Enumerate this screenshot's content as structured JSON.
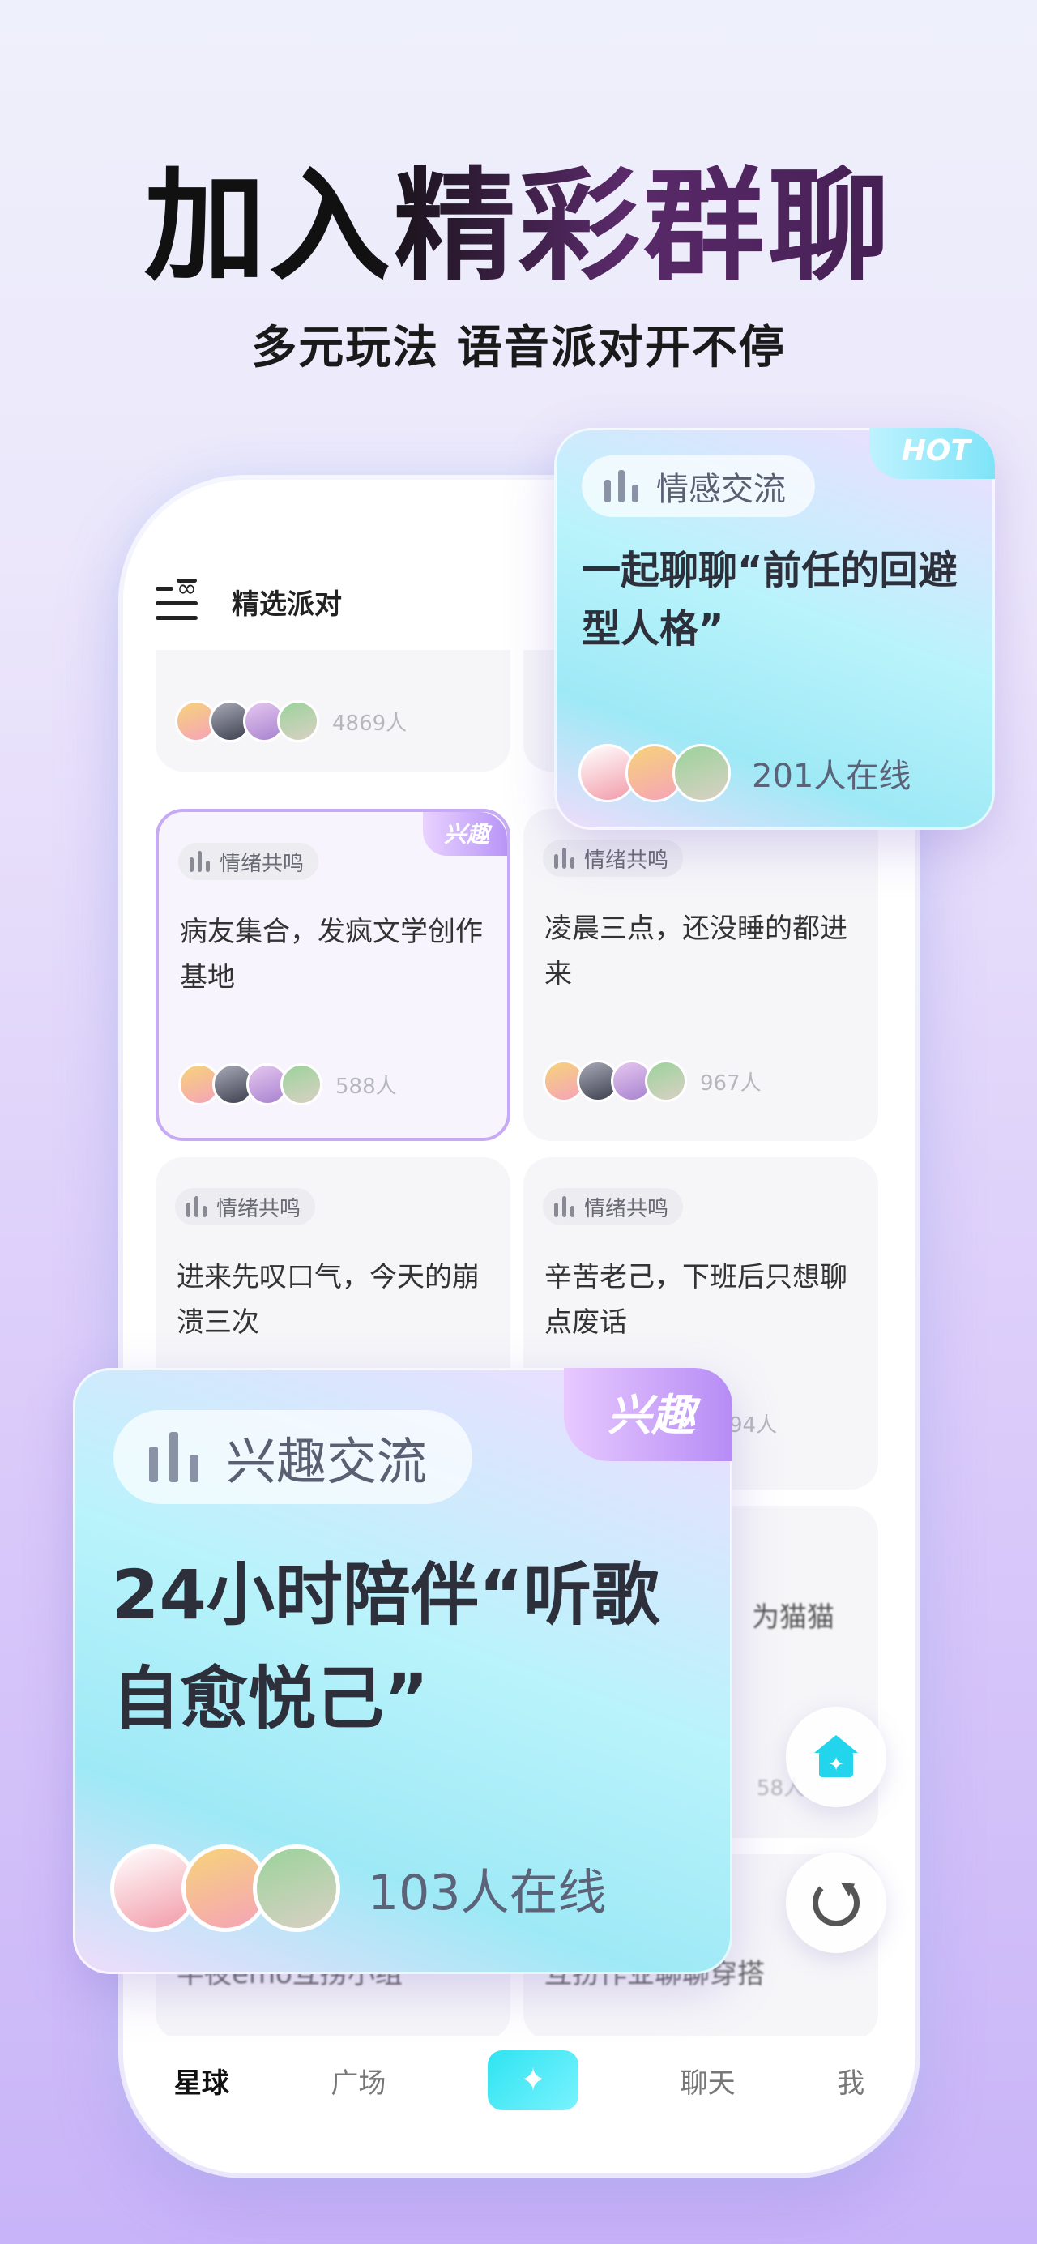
{
  "hero": {
    "title": "加入精彩群聊",
    "subtitle": "多元玩法 语音派对开不停"
  },
  "header": {
    "title": "精选派对"
  },
  "cards": [
    {
      "tag": "",
      "title": "",
      "count": "4869人",
      "badge": ""
    },
    {
      "tag": "情绪共鸣",
      "title": "病友集合，发疯文学创作基地",
      "count": "588人",
      "badge": "兴趣"
    },
    {
      "tag": "情绪共鸣",
      "title": "凌晨三点，还没睡的都进来",
      "count": "967人",
      "badge": ""
    },
    {
      "tag": "情绪共鸣",
      "title": "进来先叹口气，今天的崩溃三次",
      "count": "",
      "badge": ""
    },
    {
      "tag": "情绪共鸣",
      "title": "辛苦老己，下班后只想聊点废话",
      "count": "94人",
      "badge": ""
    }
  ],
  "partial": {
    "right_title": "为猫猫",
    "right_count": "58人",
    "left_bottom": "半夜emo互捞小组",
    "right_bottom": "互扮作业聊聊穿搭"
  },
  "hot_card": {
    "tag": "情感交流",
    "title": "一起聊聊“前任的回避型人格”",
    "badge": "HOT",
    "online": "201人在线"
  },
  "interest_card": {
    "tag": "兴趣交流",
    "title": "24小时陪伴“听歌自愈悦己”",
    "badge": "兴趣",
    "online": "103人在线"
  },
  "nav": {
    "items": [
      "星球",
      "广场",
      "聊天",
      "我"
    ],
    "active": "星球"
  },
  "icons": {
    "menu": "menu-icon",
    "home": "home-sparkle-icon",
    "refresh": "refresh-icon",
    "center": "sparkle-icon"
  },
  "colors": {
    "accent_cyan": "#2ee4f0",
    "accent_purple": "#b68cf5"
  }
}
